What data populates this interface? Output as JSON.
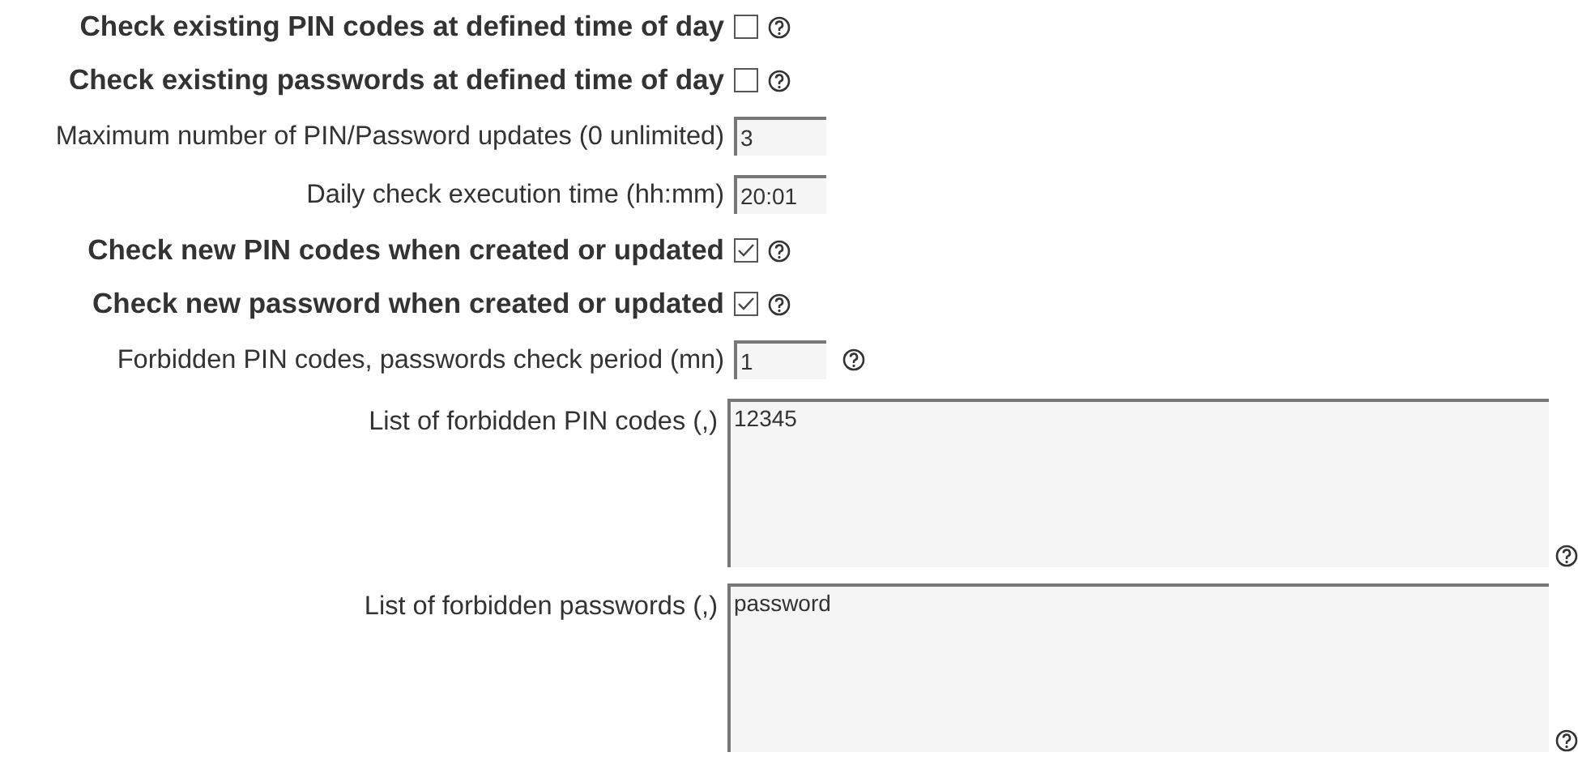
{
  "fields": [
    {
      "kind": "checkbox",
      "label": "Check existing PIN codes at defined time of day",
      "checked": false,
      "help": true
    },
    {
      "kind": "checkbox",
      "label": "Check existing passwords at defined time of day",
      "checked": false,
      "help": true
    },
    {
      "kind": "text",
      "label": "Maximum number of PIN/Password updates (0 unlimited)",
      "value": "3",
      "help": false
    },
    {
      "kind": "text",
      "label": "Daily check execution time (hh:mm)",
      "value": "20:01",
      "help": false
    },
    {
      "kind": "checkbox",
      "label": "Check new PIN codes when created or updated",
      "checked": true,
      "help": true
    },
    {
      "kind": "checkbox",
      "label": "Check new password when created or updated",
      "checked": true,
      "help": true
    },
    {
      "kind": "text",
      "label": "Forbidden PIN codes, passwords check period (mn)",
      "value": "1",
      "help": true
    },
    {
      "kind": "textarea",
      "label": "List of forbidden PIN codes (,)",
      "value": "12345",
      "help": true
    },
    {
      "kind": "textarea",
      "label": "List of forbidden passwords (,)",
      "value": "password",
      "help": true
    }
  ]
}
